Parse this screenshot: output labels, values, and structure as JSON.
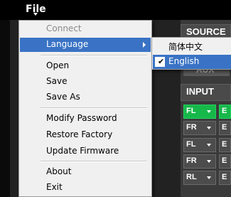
{
  "menubar": {
    "file_label": "File"
  },
  "app": {
    "source_label": "SOURCE",
    "aux_label": "AUX",
    "input_label": "INPUT",
    "input_rows": [
      {
        "channel": "FL",
        "active": true,
        "e": "E"
      },
      {
        "channel": "FR",
        "active": false,
        "e": "E"
      },
      {
        "channel": "FL",
        "active": false,
        "e": "E"
      },
      {
        "channel": "FR",
        "active": false,
        "e": "E"
      },
      {
        "channel": "RL",
        "active": false,
        "e": "E"
      }
    ]
  },
  "file_menu": {
    "connect": "Connect",
    "language": "Language",
    "open": "Open",
    "save": "Save",
    "save_as": "Save As",
    "modify_password": "Modify Password",
    "restore_factory": "Restore Factory",
    "update_firmware": "Update Firmware",
    "about": "About",
    "exit": "Exit"
  },
  "language_menu": {
    "chinese": "简体中文",
    "english": "English",
    "checked": "English"
  },
  "colors": {
    "highlight": "#3a73c5",
    "active_green": "#17b84a"
  }
}
